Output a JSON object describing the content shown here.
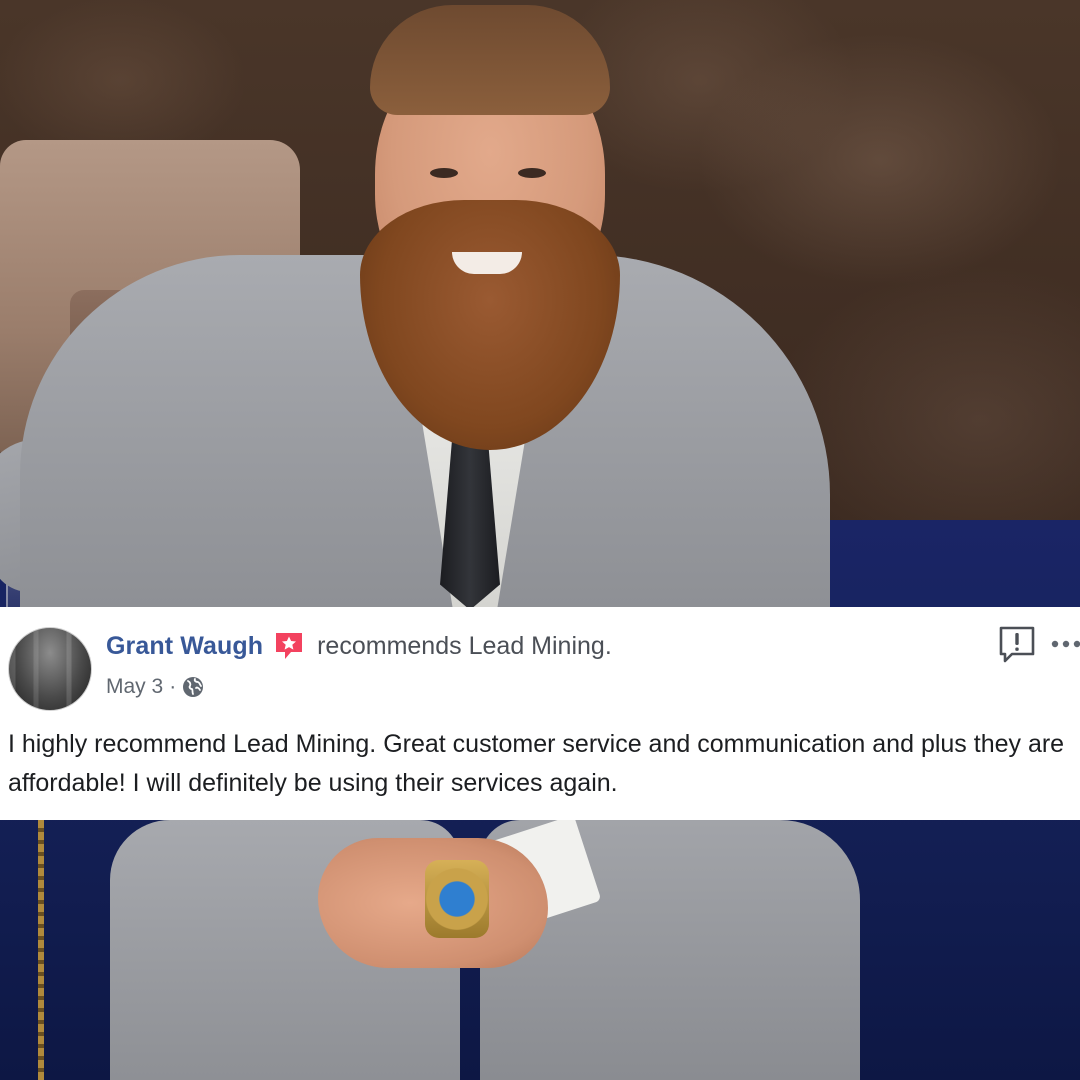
{
  "review": {
    "author_name": "Grant Waugh",
    "recommends_label": "recommends",
    "page_name": "Lead Mining.",
    "date": "May 3",
    "separator": "·",
    "privacy_icon": "globe-icon",
    "text": "I highly recommend Lead Mining. Great customer service and communication and plus they are affordable! I will definitely be using their services again."
  },
  "icons": {
    "recommend_badge": "recommend-badge-icon",
    "report": "report-icon",
    "more": "more-options-icon"
  },
  "colors": {
    "author_link": "#385898",
    "badge": "#f3425f",
    "meta_text": "#606770",
    "body_text": "#1c1e21"
  }
}
